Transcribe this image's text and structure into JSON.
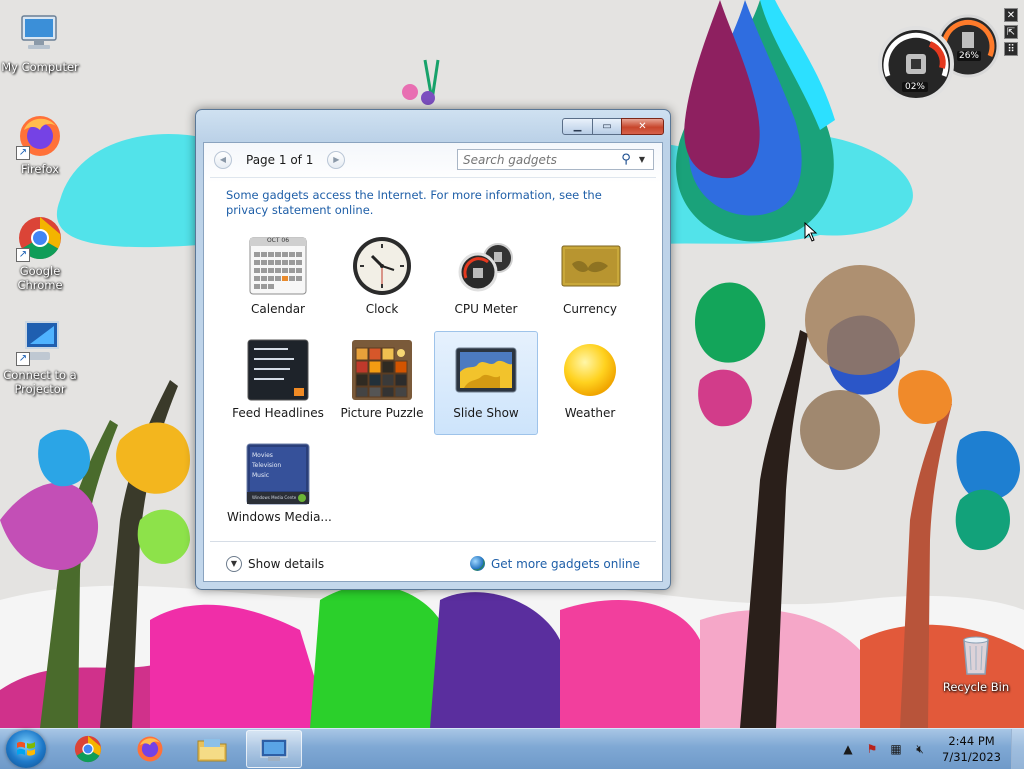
{
  "desktop": {
    "icons": [
      {
        "label": "My Computer"
      },
      {
        "label": "Firefox"
      },
      {
        "label": "Google Chrome"
      },
      {
        "label": "Connect to a Projector"
      },
      {
        "label": "Recycle Bin"
      }
    ]
  },
  "cpu_meter": {
    "cpu_percent": "02%",
    "memory_percent": "26%",
    "close_glyph": "✕",
    "resize_glyph": "⇱",
    "drag_glyph": "⠿"
  },
  "gallery": {
    "page_label": "Page 1 of 1",
    "search_placeholder": "Search gadgets",
    "notice": "Some gadgets access the Internet.  For more information, see the privacy statement online.",
    "gadgets": [
      {
        "label": "Calendar",
        "icon": "calendar-icon",
        "cal_month": "OCT 06"
      },
      {
        "label": "Clock",
        "icon": "clock-icon"
      },
      {
        "label": "CPU Meter",
        "icon": "cpu-meter-icon"
      },
      {
        "label": "Currency",
        "icon": "currency-icon"
      },
      {
        "label": "Feed Headlines",
        "icon": "feed-headlines-icon"
      },
      {
        "label": "Picture Puzzle",
        "icon": "picture-puzzle-icon"
      },
      {
        "label": "Slide Show",
        "icon": "slide-show-icon",
        "selected": true
      },
      {
        "label": "Weather",
        "icon": "weather-icon"
      },
      {
        "label": "Windows Media...",
        "icon": "windows-media-center-icon",
        "menu": [
          "Movies",
          "Television",
          "Music"
        ],
        "bar_text": "Windows Media Center"
      }
    ],
    "show_details": "Show details",
    "get_more": "Get more gadgets online"
  },
  "taskbar": {
    "time": "2:44 PM",
    "date": "7/31/2023"
  },
  "colors": {
    "link": "#1f5fa8",
    "selection": "#cde4fb",
    "close_button": "#c7462c"
  }
}
